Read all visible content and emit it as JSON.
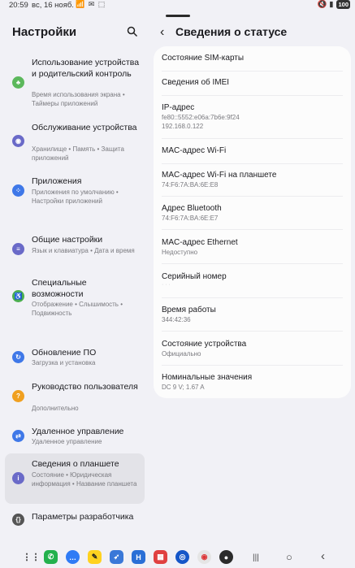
{
  "status_bar": {
    "time": "20:59",
    "date": "вс, 16 нояб.",
    "notifications": "📶 ✉ ⬚",
    "right_icons": "🔇 ▮",
    "battery": "100"
  },
  "left": {
    "title": "Настройки",
    "items": [
      {
        "title": "Использование устройства и родительский контроль",
        "subtitle": "Время использования экрана • Таймеры приложений",
        "icon": "leaf-icon",
        "color": "#5cb85c"
      },
      {
        "title": "Обслуживание устройства",
        "subtitle": "Хранилище • Память • Защита приложений",
        "icon": "maintenance-icon",
        "color": "#6a6ac8"
      },
      {
        "title": "Приложения",
        "subtitle": "Приложения по умолчанию • Настройки приложений",
        "icon": "apps-icon",
        "color": "#3f78e8"
      },
      {
        "title": "Общие настройки",
        "subtitle": "Язык и клавиатура • Дата и время",
        "icon": "general-icon",
        "color": "#6a6ac8"
      },
      {
        "title": "Специальные возможности",
        "subtitle": "Отображение • Слышимость • Подвижность",
        "icon": "accessibility-icon",
        "color": "#4caf50"
      },
      {
        "title": "Обновление ПО",
        "subtitle": "Загрузка и установка",
        "icon": "update-icon",
        "color": "#3f78e8"
      },
      {
        "title": "Руководство пользователя",
        "subtitle": "Дополнительно",
        "icon": "manual-icon",
        "color": "#f0a020"
      },
      {
        "title": "Удаленное управление",
        "subtitle": "Удаленное управление",
        "icon": "remote-icon",
        "color": "#3f78e8"
      },
      {
        "title": "Сведения о планшете",
        "subtitle": "Состояние • Юридическая информация • Название планшета",
        "icon": "info-icon",
        "color": "#6a6ac8"
      },
      {
        "title": "Параметры разработчика",
        "subtitle": "",
        "icon": "developer-icon",
        "color": "#555555"
      }
    ]
  },
  "right": {
    "title": "Сведения о статусе",
    "rows": [
      {
        "title": "Состояние SIM-карты",
        "subtitle": ""
      },
      {
        "title": "Сведения об IMEI",
        "subtitle": ""
      },
      {
        "title": "IP-адрес",
        "subtitle": "fe80::5552:e06a:7b6e:9f24\n192.168.0.122"
      },
      {
        "title": "MAC-адрес Wi-Fi",
        "subtitle": ""
      },
      {
        "title": "MAC-адрес Wi-Fi на планшете",
        "subtitle": "74:F6:7A:BA:6E:E8"
      },
      {
        "title": "Адрес Bluetooth",
        "subtitle": "74:F6:7A:BA:6E:E7"
      },
      {
        "title": "MAC-адрес Ethernet",
        "subtitle": "Недоступно"
      },
      {
        "title": "Серийный номер",
        "subtitle": ""
      },
      {
        "title": "Время работы",
        "subtitle": "344:42:36"
      },
      {
        "title": "Состояние устройства",
        "subtitle": "Официально"
      },
      {
        "title": "Номинальные значения",
        "subtitle": "DC 9 V; 1.67 A"
      }
    ]
  },
  "dock": {
    "apps": [
      {
        "icon": "app-drawer-icon",
        "glyph": "⋮⋮",
        "color": "transparent"
      },
      {
        "icon": "phone-icon",
        "glyph": "✆",
        "color": "#23b14d"
      },
      {
        "icon": "messages-icon",
        "glyph": "…",
        "color": "#2f7bf5"
      },
      {
        "icon": "messenger-icon",
        "glyph": "✎",
        "color": "#ffd21f"
      },
      {
        "icon": "arrows-icon",
        "glyph": "➶",
        "color": "#3a78d8"
      },
      {
        "icon": "h-app-icon",
        "glyph": "H",
        "color": "#2a6fd6"
      },
      {
        "icon": "game-icon",
        "glyph": "▦",
        "color": "#e04040"
      },
      {
        "icon": "browser-icon",
        "glyph": "◎",
        "color": "#1556c8"
      },
      {
        "icon": "chrome-icon",
        "glyph": "◉",
        "color": "#e5e5e5"
      },
      {
        "icon": "camera-icon",
        "glyph": "●",
        "color": "#2b2b2b"
      }
    ],
    "nav": [
      {
        "icon": "recents-icon",
        "glyph": "|||"
      },
      {
        "icon": "home-icon",
        "glyph": "○"
      },
      {
        "icon": "back-icon",
        "glyph": "‹"
      }
    ]
  }
}
